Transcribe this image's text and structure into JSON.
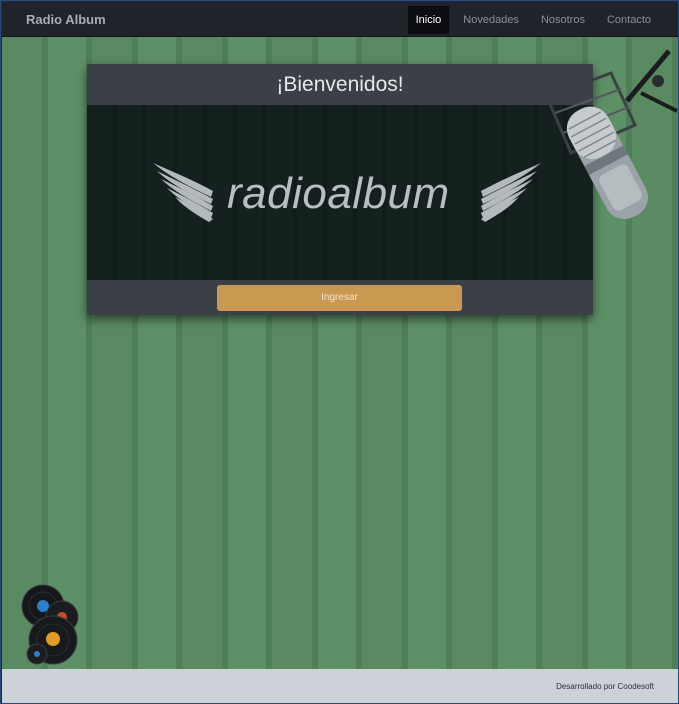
{
  "navbar": {
    "brand": "Radio Album",
    "items": [
      {
        "label": "Inicio",
        "active": true
      },
      {
        "label": "Novedades",
        "active": false
      },
      {
        "label": "Nosotros",
        "active": false
      },
      {
        "label": "Contacto",
        "active": false
      }
    ]
  },
  "card": {
    "title": "¡Bienvenidos!",
    "logo_text": "radioalbum",
    "button_label": "Ingresar"
  },
  "footer": {
    "credit": "Desarrollado por Coodesoft"
  },
  "colors": {
    "navbar": "#202329",
    "background_green": "#5a8a62",
    "card": "#3a4046",
    "button": "#c99952",
    "footer": "#cdd2d9"
  },
  "icons": [
    "microphone-illustration",
    "vinyl-records-illustration",
    "wings-logo"
  ]
}
